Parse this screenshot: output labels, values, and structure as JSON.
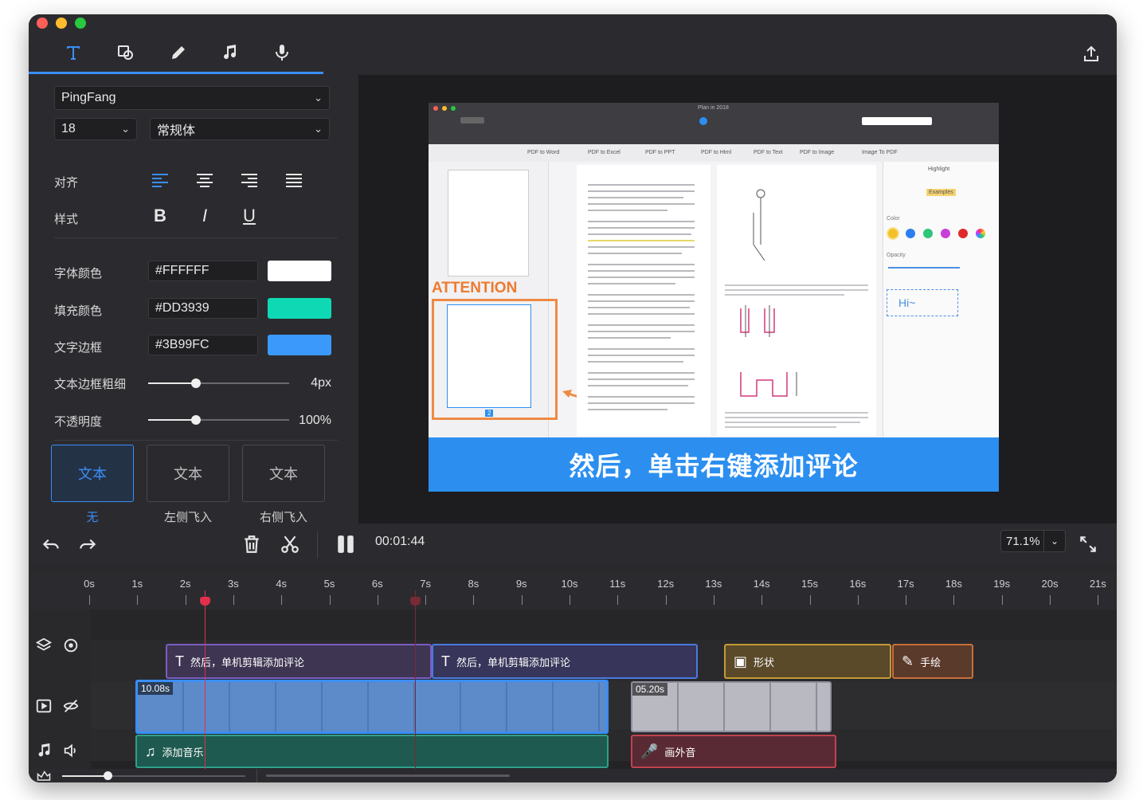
{
  "toolbar": {
    "tools": [
      "text-tool",
      "shape-tool",
      "draw-tool",
      "music-tool",
      "voice-tool"
    ],
    "export_icon": "upload-icon"
  },
  "sidebar": {
    "font_family": "PingFang",
    "font_size": "18",
    "font_weight": "常规体",
    "align_label": "对齐",
    "style_label": "样式",
    "style_buttons": [
      "B",
      "I",
      "U"
    ],
    "font_color_label": "字体颜色",
    "font_color": "#FFFFFF",
    "fill_color_label": "填充颜色",
    "fill_color": "#DD3939",
    "fill_swatch": "#0fd9b5",
    "border_color_label": "文字边框",
    "border_color": "#3B99FC",
    "border_swatch": "#3b99fc",
    "border_width_label": "文本边框粗细",
    "border_width": "4px",
    "border_width_level": 0.34,
    "opacity_label": "不透明度",
    "opacity": "100%",
    "opacity_level": 0.34,
    "animations": [
      {
        "preview": "文本",
        "label": "无"
      },
      {
        "preview": "文本",
        "label": "左侧飞入"
      },
      {
        "preview": "文本",
        "label": "右侧飞入"
      }
    ]
  },
  "preview": {
    "caption": "然后，单击右键添加评论",
    "attention": "ATTENTION",
    "doc_title": "Plan in 2018",
    "menu": [
      "PDF to Word",
      "PDF to Excel",
      "PDF to PPT",
      "PDF to Html",
      "PDF to Text",
      "PDF to Image",
      "Image To PDF"
    ],
    "right_panel": {
      "header": "Highlight",
      "examples": "Examples",
      "color_label": "Color",
      "opacity_label": "Opacity",
      "sample": "Hi~"
    },
    "page_badge": "2"
  },
  "timeline": {
    "time": "00:01:44",
    "zoom": "71.1%",
    "ticks": [
      "0s",
      "1s",
      "2s",
      "3s",
      "4s",
      "5s",
      "6s",
      "7s",
      "8s",
      "9s",
      "10s",
      "11s",
      "12s",
      "13s",
      "14s",
      "15s",
      "16s",
      "17s",
      "18s",
      "19s",
      "20s",
      "21s"
    ],
    "clips": {
      "text1": "然后，单机剪辑添加评论",
      "text2": "然后，单机剪辑添加评论",
      "shape": "形状",
      "draw": "手绘",
      "video1_duration": "10.08s",
      "video2_duration": "05.20s",
      "music": "添加音乐",
      "voice": "画外音"
    }
  }
}
